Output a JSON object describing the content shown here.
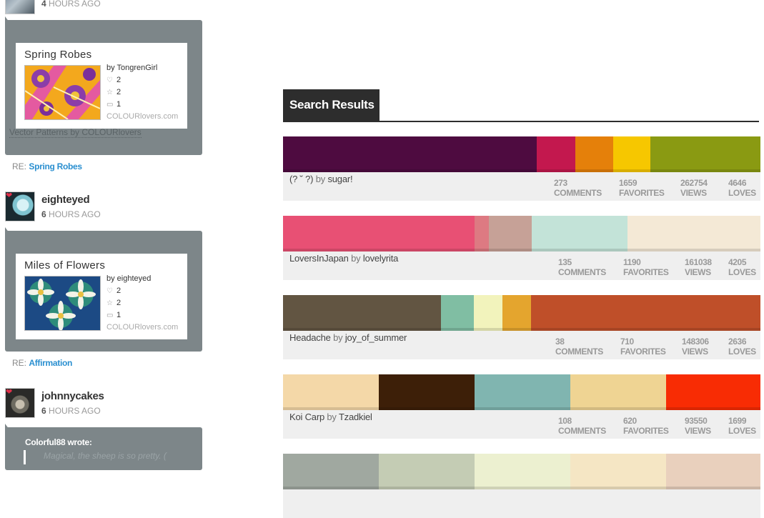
{
  "feed": {
    "top_time": {
      "num": "4",
      "unit": "HOURS AGO"
    },
    "cards": [
      {
        "title": "Spring Robes",
        "by": "by TongrenGirl",
        "loves": "2",
        "favorites": "2",
        "comments": "1",
        "site": "COLOURlovers.com",
        "caption": "Vector Patterns by COLOURlovers",
        "re_prefix": "RE:",
        "re_link": "Spring Robes"
      },
      {
        "title": "Miles of Flowers",
        "by": "by eighteyed",
        "loves": "2",
        "favorites": "2",
        "comments": "1",
        "site": "COLOURlovers.com",
        "caption": "",
        "re_prefix": "RE:",
        "re_link": "Affirmation"
      }
    ],
    "users": [
      {
        "name": "eighteyed",
        "time_num": "6",
        "time_unit": "HOURS AGO"
      },
      {
        "name": "johnnycakes",
        "time_num": "6",
        "time_unit": "HOURS AGO"
      }
    ],
    "quote": {
      "author": "Colorful88 wrote:",
      "text": "Magical, the sheep is so pretty. ("
    }
  },
  "search": {
    "tab_label": "Search Results",
    "results": [
      {
        "title": "(? ˘ ?)",
        "by_word": "by",
        "author": "sugar!",
        "colors": [
          "#4e0b40",
          "#c3184e",
          "#e5800a",
          "#f6c700",
          "#8a9a12"
        ],
        "widths": [
          355,
          54,
          53,
          52,
          154
        ],
        "comments": "273",
        "favorites": "1659",
        "views": "262754",
        "loves": "4646",
        "labels": [
          "COMMENTS",
          "FAVORITES",
          "VIEWS",
          "LOVES"
        ]
      },
      {
        "title": "LoversInJapan",
        "by_word": "by",
        "author": "lovelyrita",
        "colors": [
          "#e85074",
          "#dd7a82",
          "#c6a197",
          "#c3e3d8",
          "#f4e9d6"
        ],
        "widths": [
          268,
          20,
          60,
          134,
          186
        ],
        "comments": "135",
        "favorites": "1190",
        "views": "161038",
        "loves": "4205",
        "labels": [
          "COMMENTS",
          "FAVORITES",
          "VIEWS",
          "LOVES"
        ]
      },
      {
        "title": "Headache",
        "by_word": "by",
        "author": "joy_of_summer",
        "colors": [
          "#625542",
          "#80bea3",
          "#f2f3bc",
          "#e4a52e",
          "#bf4f29"
        ],
        "widths": [
          221,
          46,
          40,
          40,
          321
        ],
        "comments": "38",
        "favorites": "710",
        "views": "148306",
        "loves": "2636",
        "labels": [
          "COMMENTS",
          "FAVORITES",
          "VIEWS",
          "LOVES"
        ]
      },
      {
        "title": "Koi Carp",
        "by_word": "by",
        "author": "Tzadkiel",
        "colors": [
          "#f4d8a8",
          "#3d1f08",
          "#80b5b0",
          "#efd493",
          "#f82c04"
        ],
        "widths": [
          134,
          134,
          134,
          134,
          132
        ],
        "comments": "108",
        "favorites": "620",
        "views": "93550",
        "loves": "1699",
        "labels": [
          "COMMENTS",
          "FAVORITES",
          "VIEWS",
          "LOVES"
        ]
      },
      {
        "title": "",
        "by_word": "",
        "author": "",
        "colors": [
          "#a0a8a0",
          "#c4ccb4",
          "#ecf0d0",
          "#f5e6c4",
          "#e9d0bd"
        ],
        "widths": [
          134,
          134,
          134,
          134,
          132
        ],
        "comments": "",
        "favorites": "",
        "views": "",
        "loves": "",
        "labels": []
      }
    ]
  }
}
